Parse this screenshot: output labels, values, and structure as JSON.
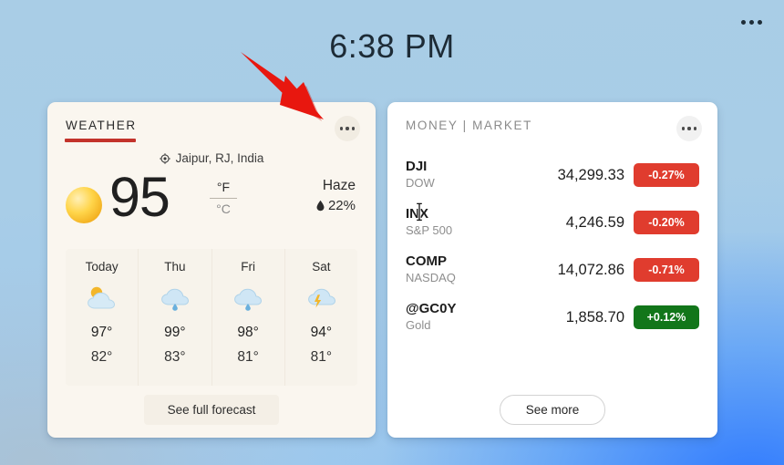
{
  "board": {
    "menu_icon": "ellipsis-icon",
    "clock": "6:38 PM"
  },
  "weather": {
    "header": "WEATHER",
    "accent_color": "#c3332b",
    "menu_icon": "ellipsis-icon",
    "location": "Jaipur, RJ, India",
    "location_icon": "location-pin-icon",
    "current_icon": "sun-icon",
    "temperature": "95",
    "unit_active": "°F",
    "unit_inactive": "°C",
    "condition": "Haze",
    "humidity": "22%",
    "humidity_icon": "water-drop-icon",
    "forecast": [
      {
        "day": "Today",
        "icon": "sun-behind-cloud-icon",
        "high": "97°",
        "low": "82°"
      },
      {
        "day": "Thu",
        "icon": "cloud-rain-icon",
        "high": "99°",
        "low": "83°"
      },
      {
        "day": "Fri",
        "icon": "cloud-rain-icon",
        "high": "98°",
        "low": "81°"
      },
      {
        "day": "Sat",
        "icon": "cloud-lightning-icon",
        "high": "94°",
        "low": "81°"
      }
    ],
    "footer_button": "See full forecast"
  },
  "money": {
    "header": "MONEY | MARKET",
    "menu_icon": "ellipsis-icon",
    "up_color": "#12761a",
    "down_color": "#e03c2e",
    "rows": [
      {
        "symbol": "DJI",
        "name": "DOW",
        "value": "34,299.33",
        "change": "-0.27%",
        "direction": "down"
      },
      {
        "symbol": "INX",
        "name": "S&P 500",
        "value": "4,246.59",
        "change": "-0.20%",
        "direction": "down"
      },
      {
        "symbol": "COMP",
        "name": "NASDAQ",
        "value": "14,072.86",
        "change": "-0.71%",
        "direction": "down"
      },
      {
        "symbol": "@GC0Y",
        "name": "Gold",
        "value": "1,858.70",
        "change": "+0.12%",
        "direction": "up"
      }
    ],
    "footer_button": "See more"
  },
  "annotation": {
    "arrow_color": "#e8170f",
    "arrow_target": "weather-card-overflow-menu"
  },
  "cursor": {
    "type": "text-ibeam-cursor"
  }
}
